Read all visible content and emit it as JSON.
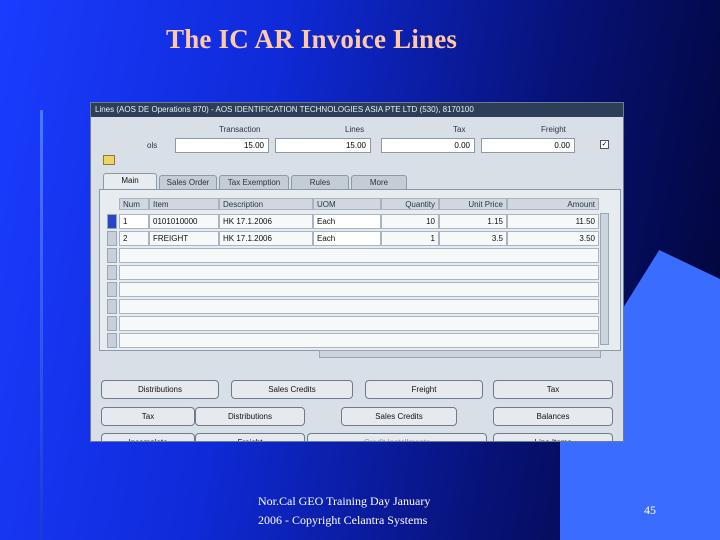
{
  "slide": {
    "title": "The IC AR Invoice Lines",
    "footer_line1": "Nor.Cal GEO Training Day January",
    "footer_line2": "2006 -  Copyright Celantra Systems",
    "page_number": "45"
  },
  "window": {
    "title": "Lines (AOS DE Operations 870) - AOS IDENTIFICATION TECHNOLOGIES ASIA PTE LTD (530), 8170100"
  },
  "totals": {
    "label": "ols",
    "headers": {
      "transaction": "Transaction",
      "lines": "Lines",
      "tax": "Tax",
      "freight": "Freight"
    },
    "values": {
      "transaction": "15.00",
      "lines": "15.00",
      "tax": "0.00",
      "freight": "0.00"
    },
    "checkbox": "✓"
  },
  "tabs": [
    "Main",
    "Sales Order",
    "Tax Exemption",
    "Rules",
    "More"
  ],
  "table": {
    "headers": [
      "Num",
      "Item",
      "Description",
      "UOM",
      "Quantity",
      "Unit Price",
      "Amount"
    ],
    "rows": [
      [
        "1",
        "0101010000",
        "HK 17.1.2006",
        "Each",
        "10",
        "1.15",
        "11.50"
      ],
      [
        "2",
        "FREIGHT",
        "HK 17.1.2006",
        "Each",
        "1",
        "3.5",
        "3.50"
      ]
    ]
  },
  "buttons_row1": [
    "Distributions",
    "Sales Credits",
    "Freight",
    "Tax"
  ],
  "buttons_row2": [
    "Tax",
    "Distributions",
    "Sales Credits",
    "Balances"
  ],
  "buttons_row3": [
    "Incomplete",
    "Freight",
    "Credit Installments",
    "Line Items"
  ]
}
